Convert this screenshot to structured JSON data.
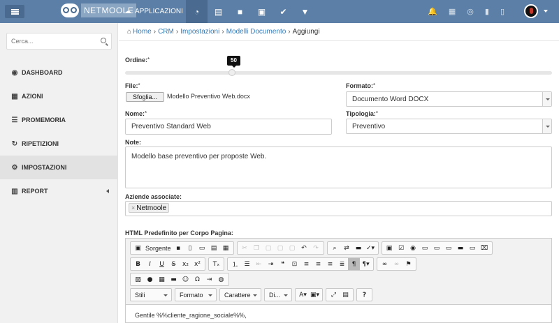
{
  "topbar": {
    "logo_text": "NETMOOLE",
    "apps_label": "APPLICAZIONI",
    "icons": [
      "dashboard-icon",
      "building-icon",
      "briefcase-icon",
      "toolbox-icon",
      "check-icon",
      "filter-icon"
    ],
    "right_icons": [
      "bell-icon",
      "calendar-icon",
      "support-icon",
      "bookmark-icon",
      "document-icon"
    ]
  },
  "sidebar": {
    "search_placeholder": "Cerca...",
    "items": [
      {
        "label": "DASHBOARD",
        "icon": "dashboard-icon",
        "glyph": "◉"
      },
      {
        "label": "AZIONI",
        "icon": "calendar-icon",
        "glyph": "▦"
      },
      {
        "label": "PROMEMORIA",
        "icon": "list-icon",
        "glyph": "☰"
      },
      {
        "label": "RIPETIZIONI",
        "icon": "refresh-icon",
        "glyph": "↻"
      },
      {
        "label": "IMPOSTAZIONI",
        "icon": "cogs-icon",
        "glyph": "⚙"
      },
      {
        "label": "REPORT",
        "icon": "bar-chart-icon",
        "glyph": "▥"
      }
    ]
  },
  "breadcrumb": {
    "home": "Home",
    "items": [
      "CRM",
      "Impostazioni",
      "Modelli Documento"
    ],
    "current": "Aggiungi"
  },
  "form": {
    "ordine_label": "Ordine:",
    "ordine_value": "50",
    "file_label": "File:",
    "file_button": "Sfoglia...",
    "file_name": "Modello Preventivo Web.docx",
    "formato_label": "Formato:",
    "formato_value": "Documento Word DOCX",
    "nome_label": "Nome:",
    "nome_value": "Preventivo Standard Web",
    "tipologia_label": "Tipologia:",
    "tipologia_value": "Preventivo",
    "note_label": "Note:",
    "note_value": "Modello base preventivo per proposte Web.",
    "aziende_label": "Aziende associate:",
    "aziende_tags": [
      "Netmoole"
    ],
    "html_label": "HTML Predefinito per Corpo Pagina:",
    "required_mark": "*"
  },
  "editor": {
    "source_label": "Sorgente",
    "combo_styles": "Stili",
    "combo_format": "Formato",
    "combo_font": "Carattere",
    "combo_size": "Di...",
    "content": "Gentile %%cliente_ragione_sociale%%,"
  }
}
